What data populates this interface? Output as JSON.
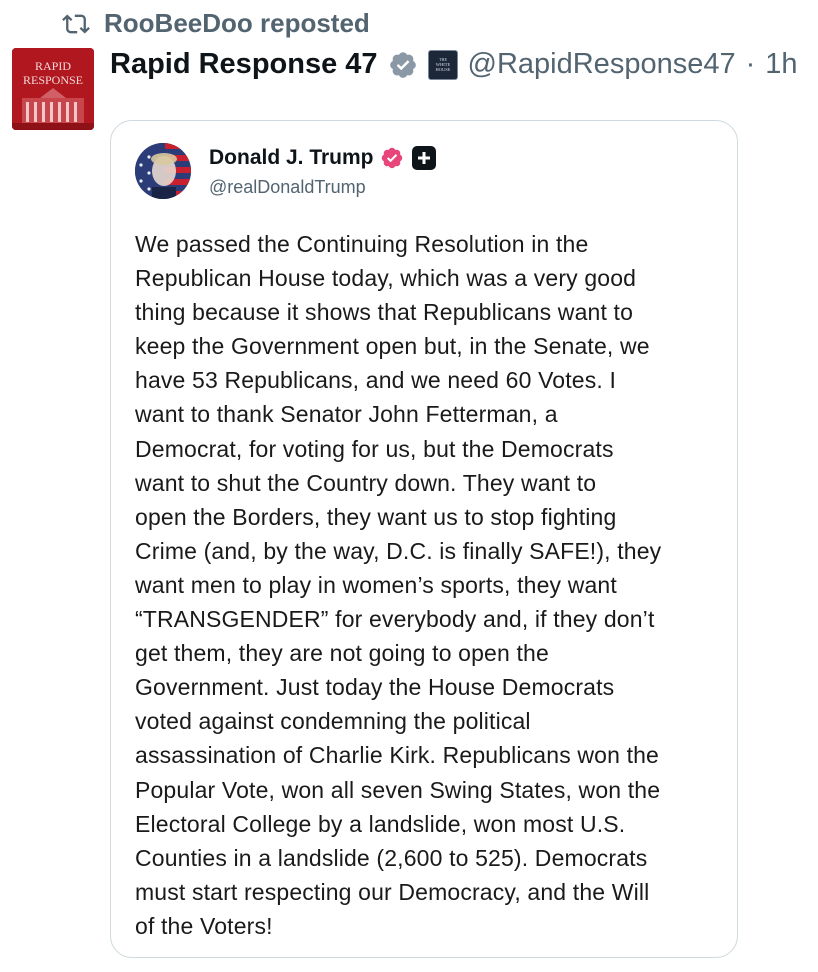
{
  "repost": {
    "label": "RooBeeDoo reposted"
  },
  "post": {
    "display_name": "Rapid Response 47",
    "handle": "@RapidResponse47",
    "separator": "·",
    "time": "1h",
    "avatar_text": [
      "RAPID",
      "RESPONSE"
    ],
    "affiliate_badge_text": [
      "THE",
      "WHITE",
      "HOUSE"
    ]
  },
  "quoted": {
    "name": "Donald J. Trump",
    "handle": "@realDonaldTrump",
    "lines": [
      "We passed the Continuing Resolution in the",
      "Republican House today, which was a very good",
      "thing because it shows that Republicans want to",
      "keep the Government open but, in the Senate, we",
      "have 53 Republicans, and we need 60 Votes. I",
      "want to thank Senator John Fetterman, a",
      "Democrat, for voting for us, but the Democrats",
      "want to shut the Country down. They want to",
      "open the Borders, they want us to stop fighting",
      "Crime (and, by the way, D.C. is finally SAFE!), they",
      "want men to play in women’s sports, they want",
      "“TRANSGENDER” for everybody and, if they don’t",
      "get them, they are not going to open the",
      "Government. Just today the House Democrats",
      "voted against condemning the political",
      "assassination of Charlie Kirk. Republicans won the",
      "Popular Vote, won all seven Swing States, won the",
      "Electoral College by a landslide, won most U.S.",
      "Counties in a landslide (2,600 to 525). Democrats",
      "must start respecting our Democracy, and the Will",
      "of the Voters!"
    ]
  },
  "colors": {
    "verified_blue": "#1d9bf0",
    "verified_pink": "#e8457b",
    "muted": "#536471",
    "avatar_red": "#b0171f"
  }
}
